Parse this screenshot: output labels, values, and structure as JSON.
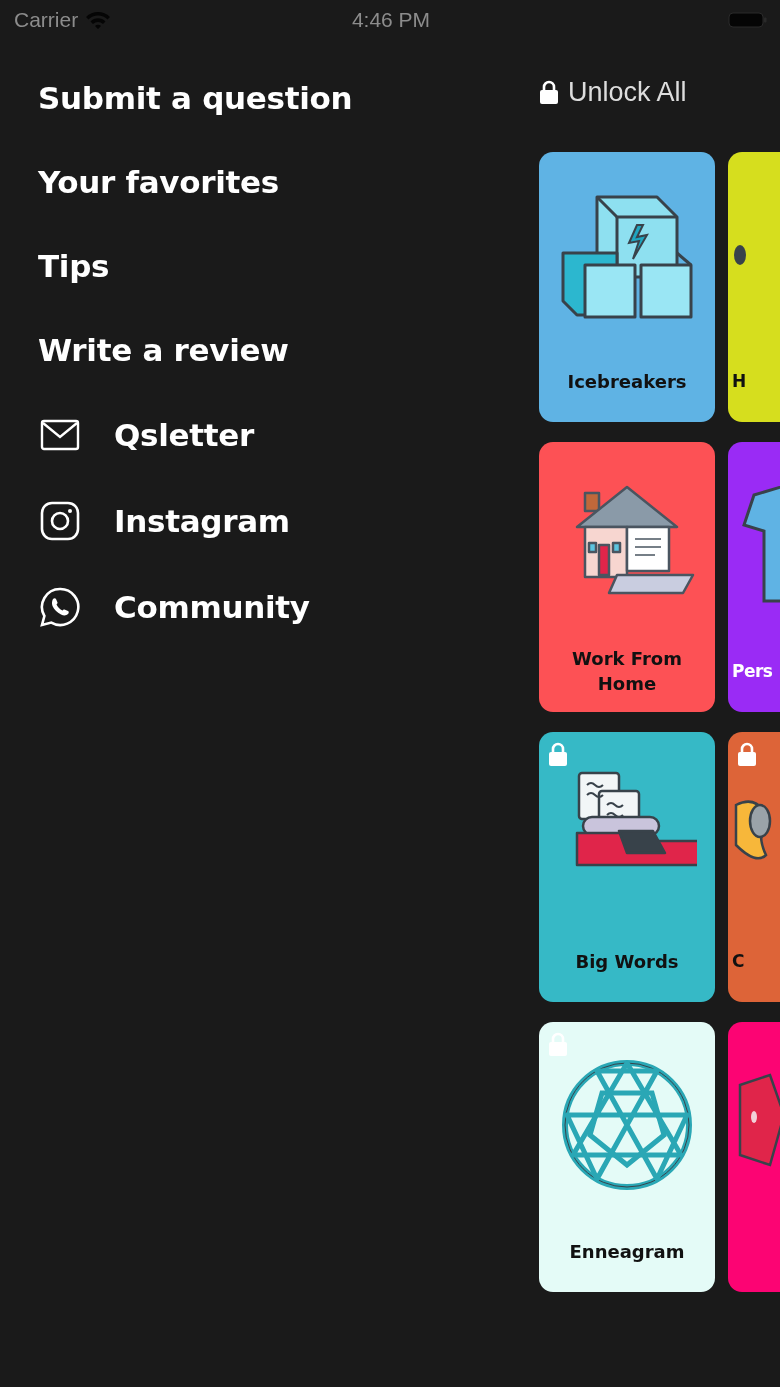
{
  "status_bar": {
    "carrier": "Carrier",
    "time": "4:46 PM"
  },
  "menu": [
    {
      "label": "Submit a question",
      "kind": "text"
    },
    {
      "label": "Your favorites",
      "kind": "text"
    },
    {
      "label": "Tips",
      "kind": "text"
    },
    {
      "label": "Write a review",
      "kind": "text"
    },
    {
      "label": "Qsletter",
      "kind": "mail"
    },
    {
      "label": "Instagram",
      "kind": "instagram"
    },
    {
      "label": "Community",
      "kind": "whatsapp"
    }
  ],
  "unlock_all": {
    "label": "Unlock All"
  },
  "cards": [
    {
      "title": "Icebreakers",
      "color": "#5fb3e4",
      "locked": false
    },
    {
      "title": "H",
      "color": "#d6de1e",
      "locked": false
    },
    {
      "title": "Work From Home",
      "color": "#fd5155",
      "locked": false
    },
    {
      "title": "Pers",
      "color": "#9a2bf5",
      "locked": false,
      "light_text": true
    },
    {
      "title": "Big Words",
      "color": "#36b9c6",
      "locked": true
    },
    {
      "title": "C",
      "color": "#dd6438",
      "locked": true
    },
    {
      "title": "Enneagram",
      "color": "#e4fbf7",
      "locked": true
    },
    {
      "color": "#fc0473",
      "locked": false
    }
  ]
}
